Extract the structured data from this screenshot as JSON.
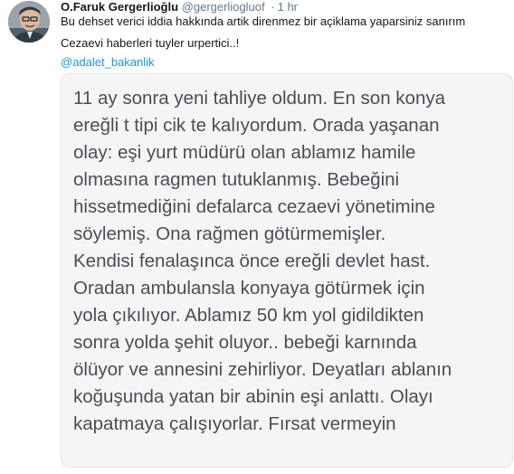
{
  "tweet": {
    "display_name": "O.Faruk Gergerlioğlu",
    "handle": "@gergerliogluof",
    "separator": "·",
    "time": "1 hr",
    "text_line1": "Bu dehset verici iddia hakkında artik direnmez bir açiklama yaparsiniz sanırım",
    "text_line2": "Cezaevi  haberleri tuyler urpertici..!",
    "mention": "@adalet_bakanlik",
    "avatar_icon": "profile-photo"
  },
  "note": {
    "lines": [
      "11 ay sonra yeni tahliye oldum. En son konya",
      "ereğli t tipi cik te kalıyordum. Orada yaşanan",
      "olay: eşi yurt müdürü olan ablamız hamile",
      "olmasına ragmen tutuklanmış. Bebeğini",
      "hissetmediğini defalarca cezaevi yönetimine",
      "söylemiş. Ona rağmen götürmemişler.",
      "Kendisi fenalaşınca önce ereğli devlet hast.",
      "Oradan ambulansla konyaya götürmek için",
      "yola çıkılıyor. Ablamız 50 km yol gidildikten",
      "sonra yolda şehit oluyor.. bebeği karnında",
      "ölüyor ve annesini zehirliyor. Deyatları ablanın",
      "koğuşunda yatan bir abinin eşi anlattı. Olayı",
      "kapatmaya çalışıyorlar. Fırsat vermeyin"
    ]
  }
}
